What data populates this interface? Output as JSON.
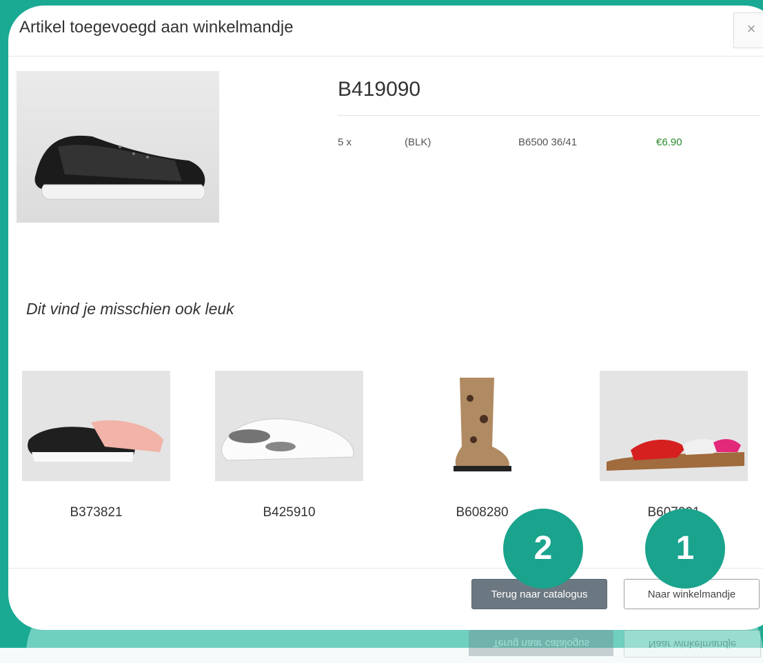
{
  "modal": {
    "title": "Artikel toegevoegd aan winkelmandje",
    "close_label": "×"
  },
  "product": {
    "code": "B419090",
    "quantity": "5 x",
    "color": "(BLK)",
    "variant": "B6500 36/41",
    "price": "€6.90"
  },
  "recommendations": {
    "title": "Dit vind je misschien ook leuk",
    "items": [
      {
        "code": "B373821"
      },
      {
        "code": "B425910"
      },
      {
        "code": "B608280"
      },
      {
        "code": "B607001"
      }
    ]
  },
  "footer": {
    "back_label": "Terug naar catalogus",
    "cart_label": "Naar winkelmandje"
  },
  "annotations": {
    "badge_1": "1",
    "badge_2": "2"
  },
  "colors": {
    "accent_teal": "#1aa38d",
    "price_green": "#2b8a2b",
    "secondary_button": "#6c7881"
  }
}
